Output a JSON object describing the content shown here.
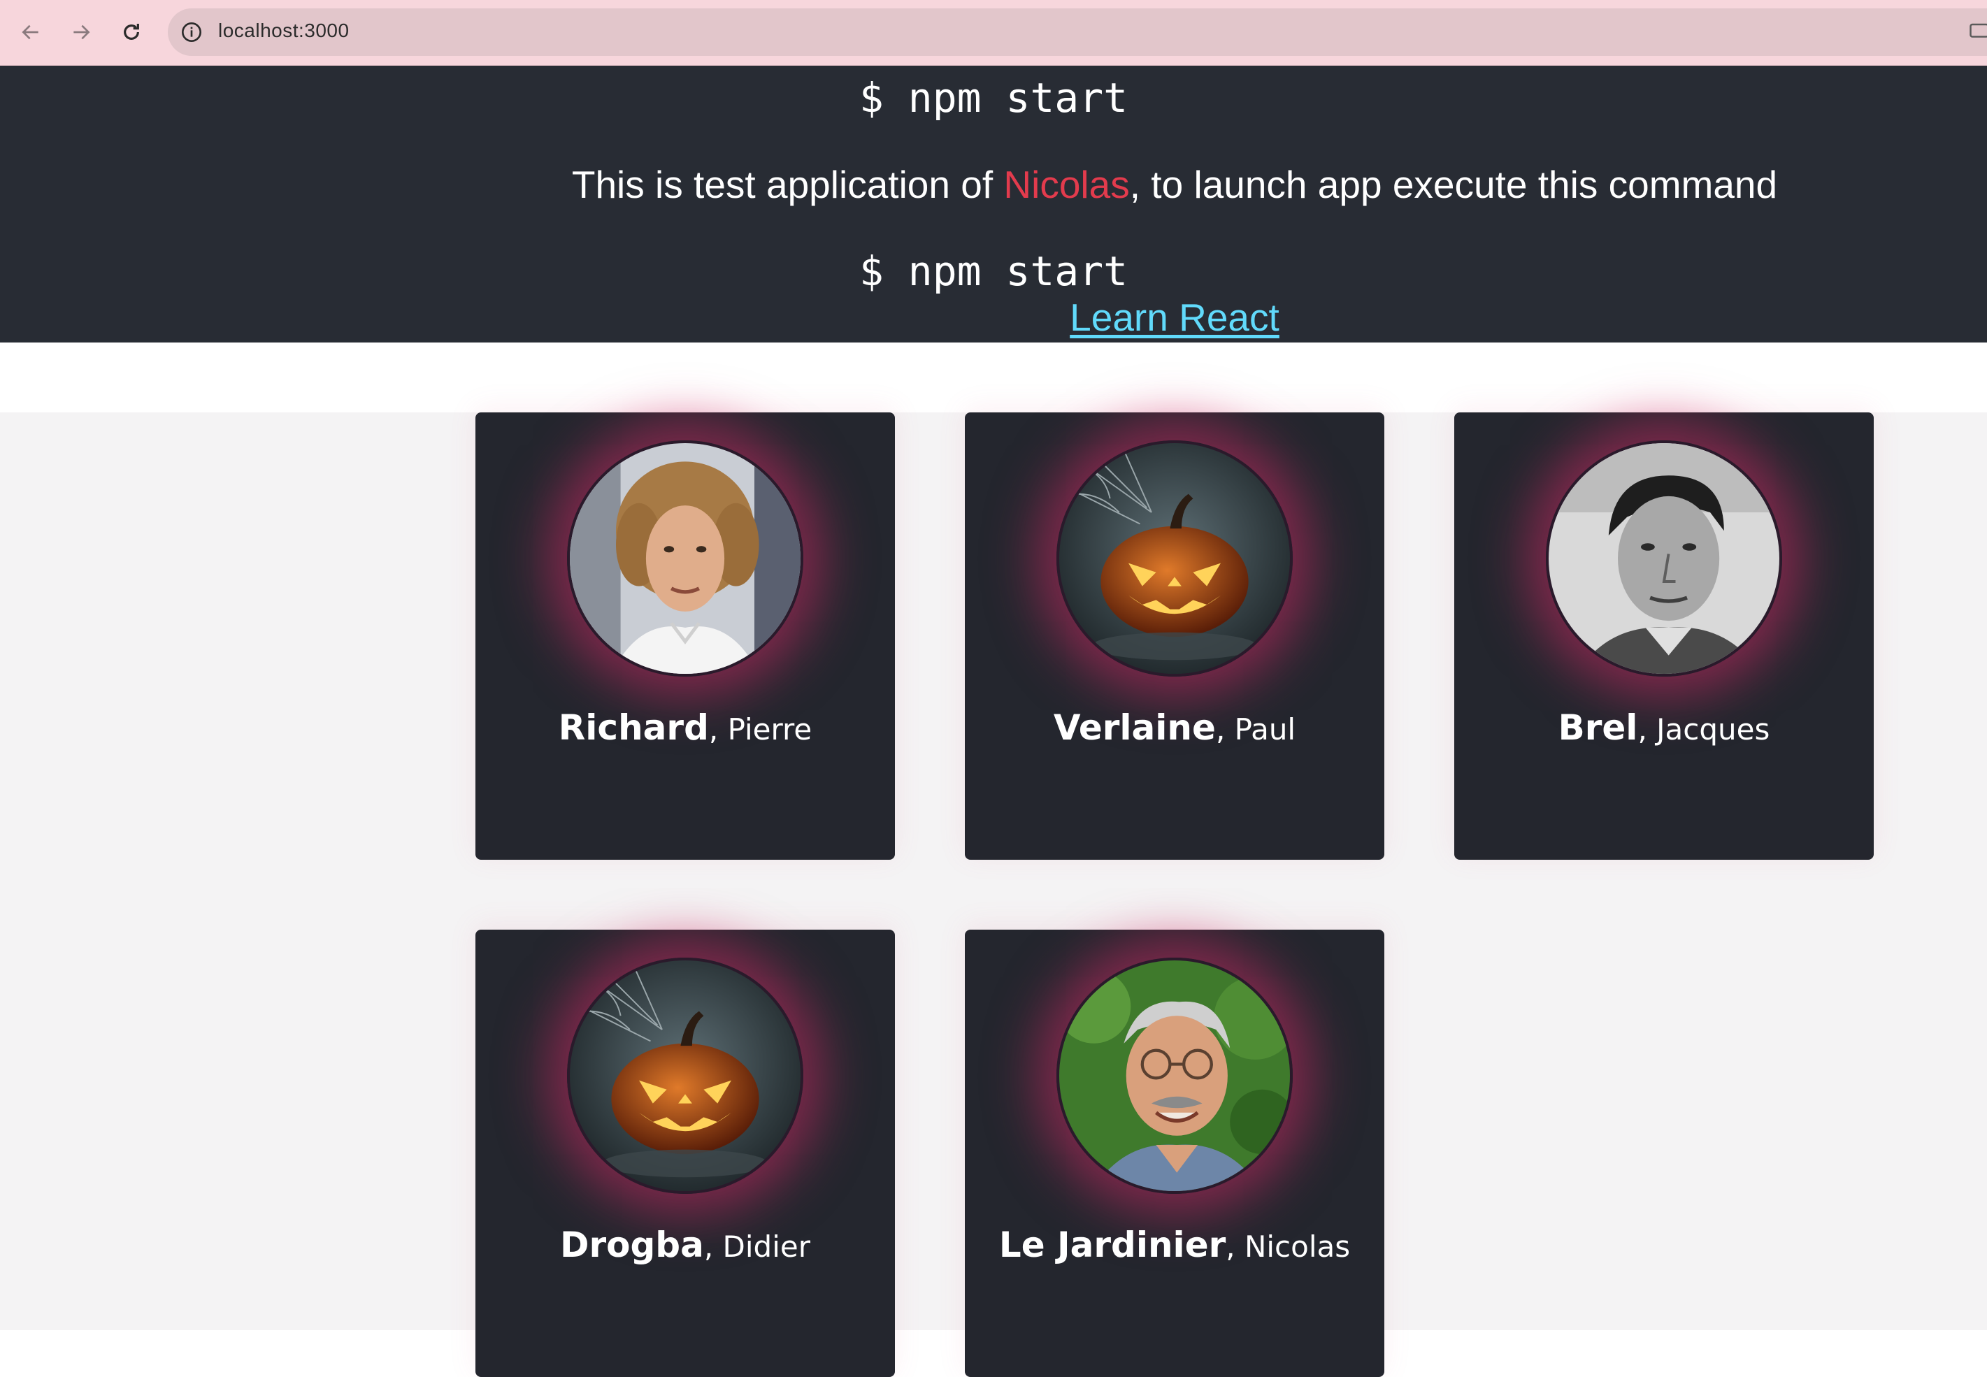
{
  "browser": {
    "url": "localhost:3000",
    "icons": {
      "back": "arrow-left-icon",
      "forward": "arrow-right-icon",
      "reload": "reload-icon",
      "info": "info-icon"
    }
  },
  "header": {
    "command": "$ npm start",
    "intro_before": "This is test application of ",
    "intro_name": "Nicolas",
    "intro_after": ", to launch app execute this command",
    "link_label": "Learn React",
    "colors": {
      "background": "#282c34",
      "name": "#e33b4d",
      "link": "#61dafb"
    }
  },
  "cards": [
    {
      "last": "Richard",
      "first": ", Pierre",
      "photo": "portrait-curly-hair"
    },
    {
      "last": "Verlaine",
      "first": ", Paul",
      "photo": "jack-o-lantern"
    },
    {
      "last": "Brel",
      "first": ", Jacques",
      "photo": "portrait-black-white"
    },
    {
      "last": "Drogba",
      "first": ", Didier",
      "photo": "jack-o-lantern"
    },
    {
      "last": "Le Jardinier",
      "first": ", Nicolas",
      "photo": "portrait-glasses-garden"
    }
  ]
}
